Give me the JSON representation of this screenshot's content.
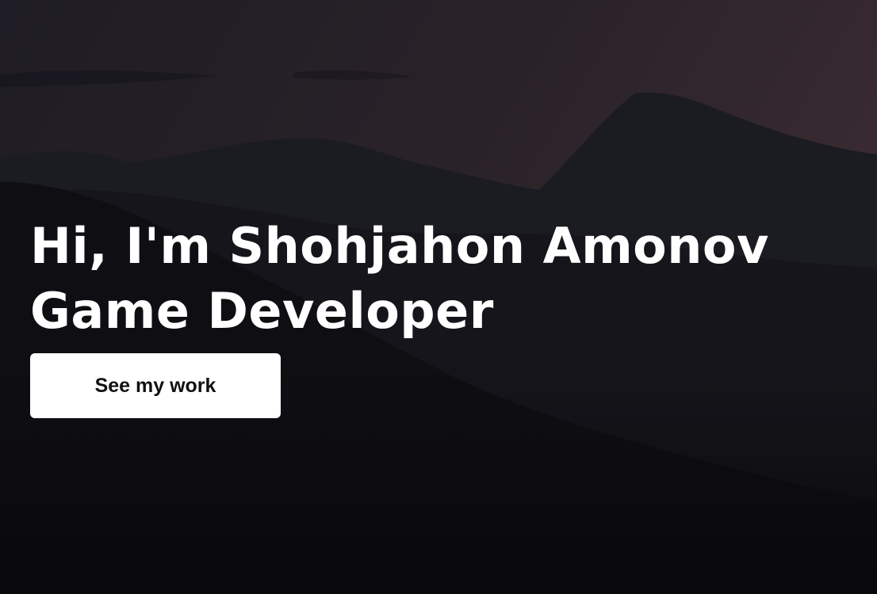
{
  "hero": {
    "line1": "Hi, I'm Shohjahon Amonov",
    "line2": "Game Developer",
    "cta_label": "See my work",
    "background_image": "mountain-silhouette-dusk",
    "colors": {
      "text": "#ffffff",
      "button_bg": "#ffffff",
      "button_text": "#111111"
    }
  }
}
